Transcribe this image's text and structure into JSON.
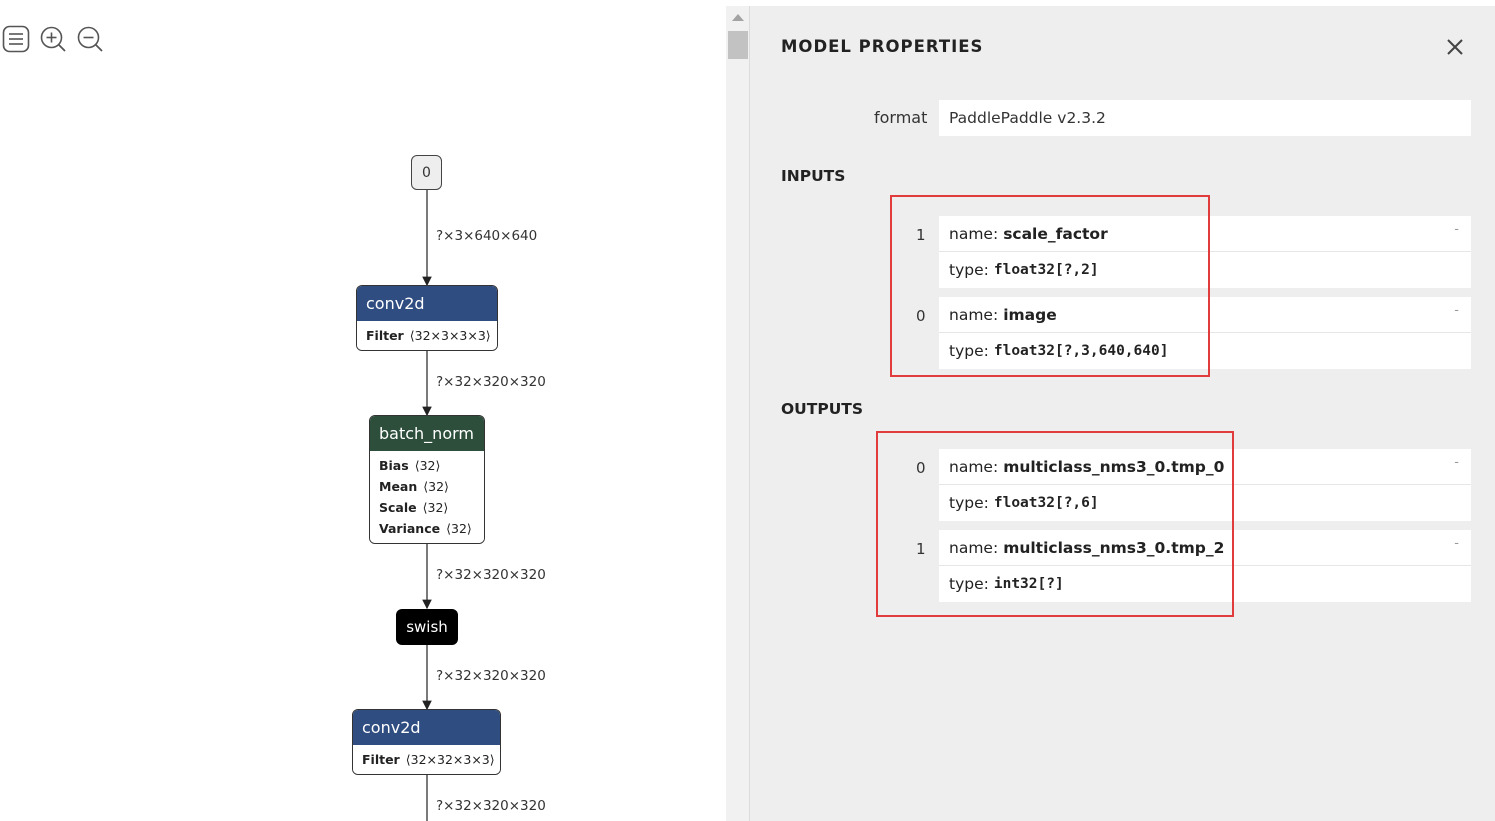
{
  "toolbar": {
    "menu_icon": "hamburger-menu-icon",
    "zoom_in_icon": "zoom-in-icon",
    "zoom_out_icon": "zoom-out-icon"
  },
  "graph": {
    "input_node": {
      "label": "0"
    },
    "edges": [
      {
        "label": "?×3×640×640"
      },
      {
        "label": "?×32×320×320"
      },
      {
        "label": "?×32×320×320"
      },
      {
        "label": "?×32×320×320"
      },
      {
        "label": "?×32×320×320"
      }
    ],
    "nodes": [
      {
        "type": "conv2d",
        "attrs": [
          {
            "name": "Filter",
            "value": "⟨32×3×3×3⟩"
          }
        ]
      },
      {
        "type": "batch_norm",
        "attrs": [
          {
            "name": "Bias",
            "value": "⟨32⟩"
          },
          {
            "name": "Mean",
            "value": "⟨32⟩"
          },
          {
            "name": "Scale",
            "value": "⟨32⟩"
          },
          {
            "name": "Variance",
            "value": "⟨32⟩"
          }
        ]
      },
      {
        "type": "swish"
      },
      {
        "type": "conv2d",
        "attrs": [
          {
            "name": "Filter",
            "value": "⟨32×32×3×3⟩"
          }
        ]
      }
    ],
    "colors": {
      "conv": "#2f4d80",
      "norm": "#2c4e3b",
      "activation": "#000000"
    }
  },
  "panel": {
    "title": "MODEL PROPERTIES",
    "close_icon": "close-icon",
    "format_label": "format",
    "format_value": "PaddlePaddle v2.3.2",
    "inputs_title": "INPUTS",
    "inputs": [
      {
        "index": "1",
        "name_label": "name:",
        "name": "scale_factor",
        "type_label": "type:",
        "type": "float32[?,2]",
        "expander": "-"
      },
      {
        "index": "0",
        "name_label": "name:",
        "name": "image",
        "type_label": "type:",
        "type": "float32[?,3,640,640]",
        "expander": "-"
      }
    ],
    "outputs_title": "OUTPUTS",
    "outputs": [
      {
        "index": "0",
        "name_label": "name:",
        "name": "multiclass_nms3_0.tmp_0",
        "type_label": "type:",
        "type": "float32[?,6]",
        "expander": "-"
      },
      {
        "index": "1",
        "name_label": "name:",
        "name": "multiclass_nms3_0.tmp_2",
        "type_label": "type:",
        "type": "int32[?]",
        "expander": "-"
      }
    ],
    "highlight_color": "#e23b3b"
  }
}
